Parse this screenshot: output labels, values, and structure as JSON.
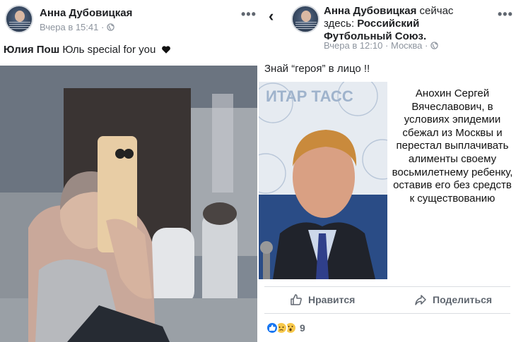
{
  "left_post": {
    "author": "Анна Дубовицкая",
    "time": "Вчера в 15:41",
    "privacy_sep": "·",
    "more": "•••",
    "tagged": "Юлия Пош",
    "text": "Юль special for you"
  },
  "right_post": {
    "back": "‹",
    "author": "Анна Дубовицкая",
    "author_suffix": " сейчас здесь: ",
    "place": "Российский Футбольный Союз.",
    "time": "Вчера в 12:10",
    "sep": "·",
    "location": "Москва",
    "more": "•••",
    "text": "Знай “героя” в лицо !!",
    "caption": "Анохин Сергей Вячеславович, в условиях эпидемии сбежал из Москвы и перестал выплачивать алименты своему восьмилетнему ребенку, оставив его без средств к существованию",
    "tass_logo": "ИТАР ТАСС",
    "like_label": "Нравится",
    "share_label": "Поделиться",
    "reaction_count": "9"
  },
  "colors": {
    "like_blue": "#1877f2",
    "meta_gray": "#8d949e",
    "action_gray": "#606770"
  }
}
